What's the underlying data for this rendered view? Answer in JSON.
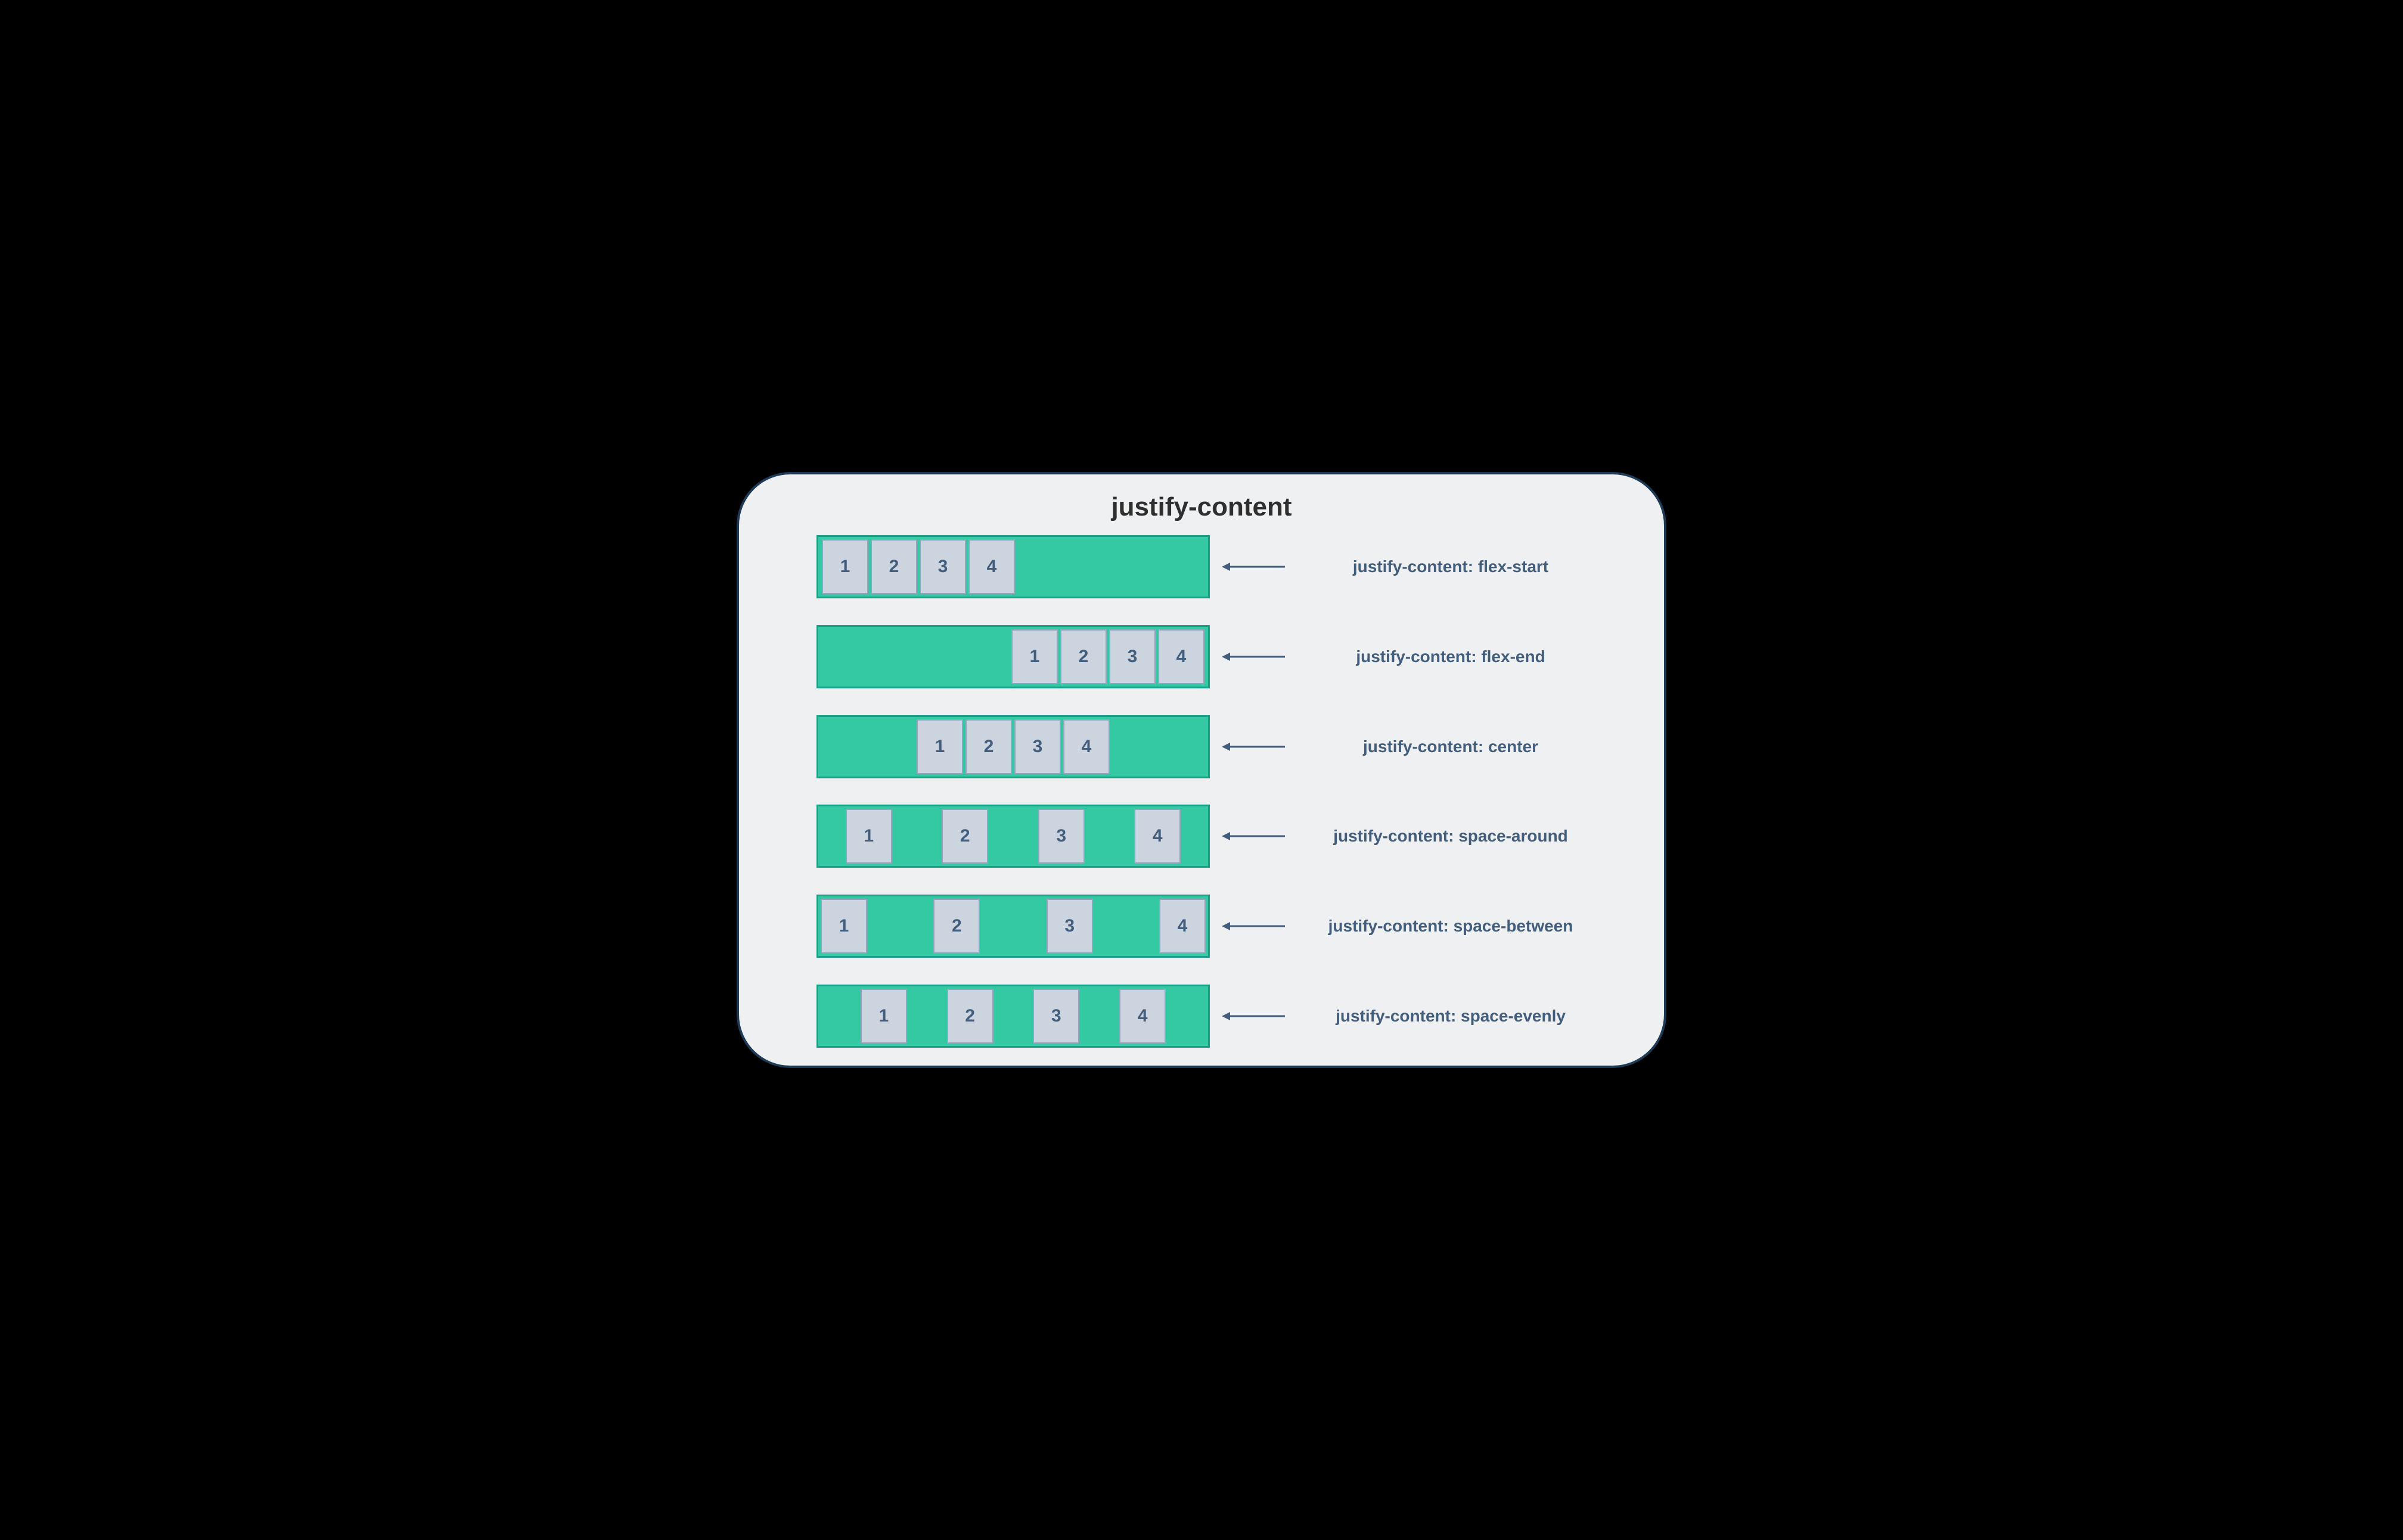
{
  "title": "justify-content",
  "items": [
    "1",
    "2",
    "3",
    "4"
  ],
  "examples": [
    {
      "value": "flex-start",
      "label": "justify-content: flex-start"
    },
    {
      "value": "flex-end",
      "label": "justify-content: flex-end"
    },
    {
      "value": "center",
      "label": "justify-content: center"
    },
    {
      "value": "space-around",
      "label": "justify-content: space-around"
    },
    {
      "value": "space-between",
      "label": "justify-content: space-between"
    },
    {
      "value": "space-evenly",
      "label": "justify-content: space-evenly"
    }
  ],
  "colors": {
    "card_bg": "#eff0f1",
    "card_border": "#1e3a54",
    "container_bg": "#34c9a3",
    "container_border": "#17a085",
    "item_bg": "#ccd4e0",
    "item_border": "#8fa8c0",
    "text": "#435d7c"
  }
}
